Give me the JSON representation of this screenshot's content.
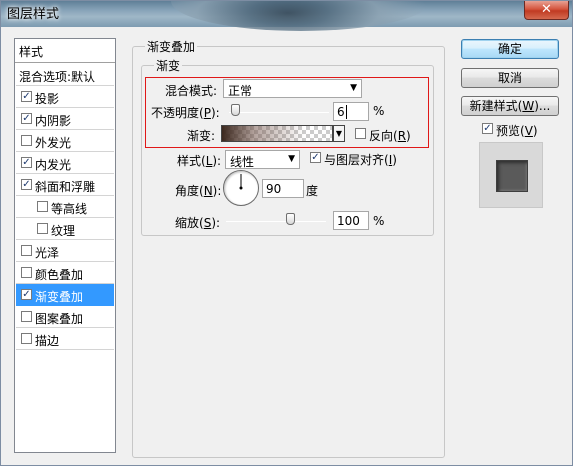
{
  "window": {
    "title": "图层样式",
    "close_glyph": "✕"
  },
  "sidebar": {
    "header": "样式",
    "blend_options": "混合选项:默认",
    "items": [
      {
        "label": "投影",
        "checked": true
      },
      {
        "label": "内阴影",
        "checked": true
      },
      {
        "label": "外发光",
        "checked": false
      },
      {
        "label": "内发光",
        "checked": true
      },
      {
        "label": "斜面和浮雕",
        "checked": true
      },
      {
        "label": "等高线",
        "checked": false
      },
      {
        "label": "纹理",
        "checked": false
      },
      {
        "label": "光泽",
        "checked": false
      },
      {
        "label": "颜色叠加",
        "checked": false
      },
      {
        "label": "渐变叠加",
        "checked": true,
        "selected": true
      },
      {
        "label": "图案叠加",
        "checked": false
      },
      {
        "label": "描边",
        "checked": false
      }
    ]
  },
  "panel": {
    "title": "渐变叠加",
    "subgroup": "渐变",
    "blend_mode_label": "混合模式:",
    "blend_mode_value": "正常",
    "opacity_label": "不透明度(P):",
    "opacity_value": "6",
    "opacity_unit": "%",
    "gradient_label": "渐变:",
    "reverse_label": "反向(R)",
    "reverse_checked": false,
    "style_label": "样式(L):",
    "style_value": "线性",
    "align_label": "与图层对齐(I)",
    "align_checked": true,
    "angle_label": "角度(N):",
    "angle_value": "90",
    "angle_unit": "度",
    "scale_label": "缩放(S):",
    "scale_value": "100",
    "scale_unit": "%"
  },
  "buttons": {
    "ok": "确定",
    "cancel": "取消",
    "new_style": "新建样式(W)...",
    "preview_label": "预览(V)",
    "preview_checked": true
  },
  "icons": {
    "dropdown": "chevron-down-icon",
    "check": "check-icon"
  },
  "colors": {
    "selection": "#3399ff",
    "highlight_frame": "#e01818",
    "close_button": "#c03a22"
  }
}
